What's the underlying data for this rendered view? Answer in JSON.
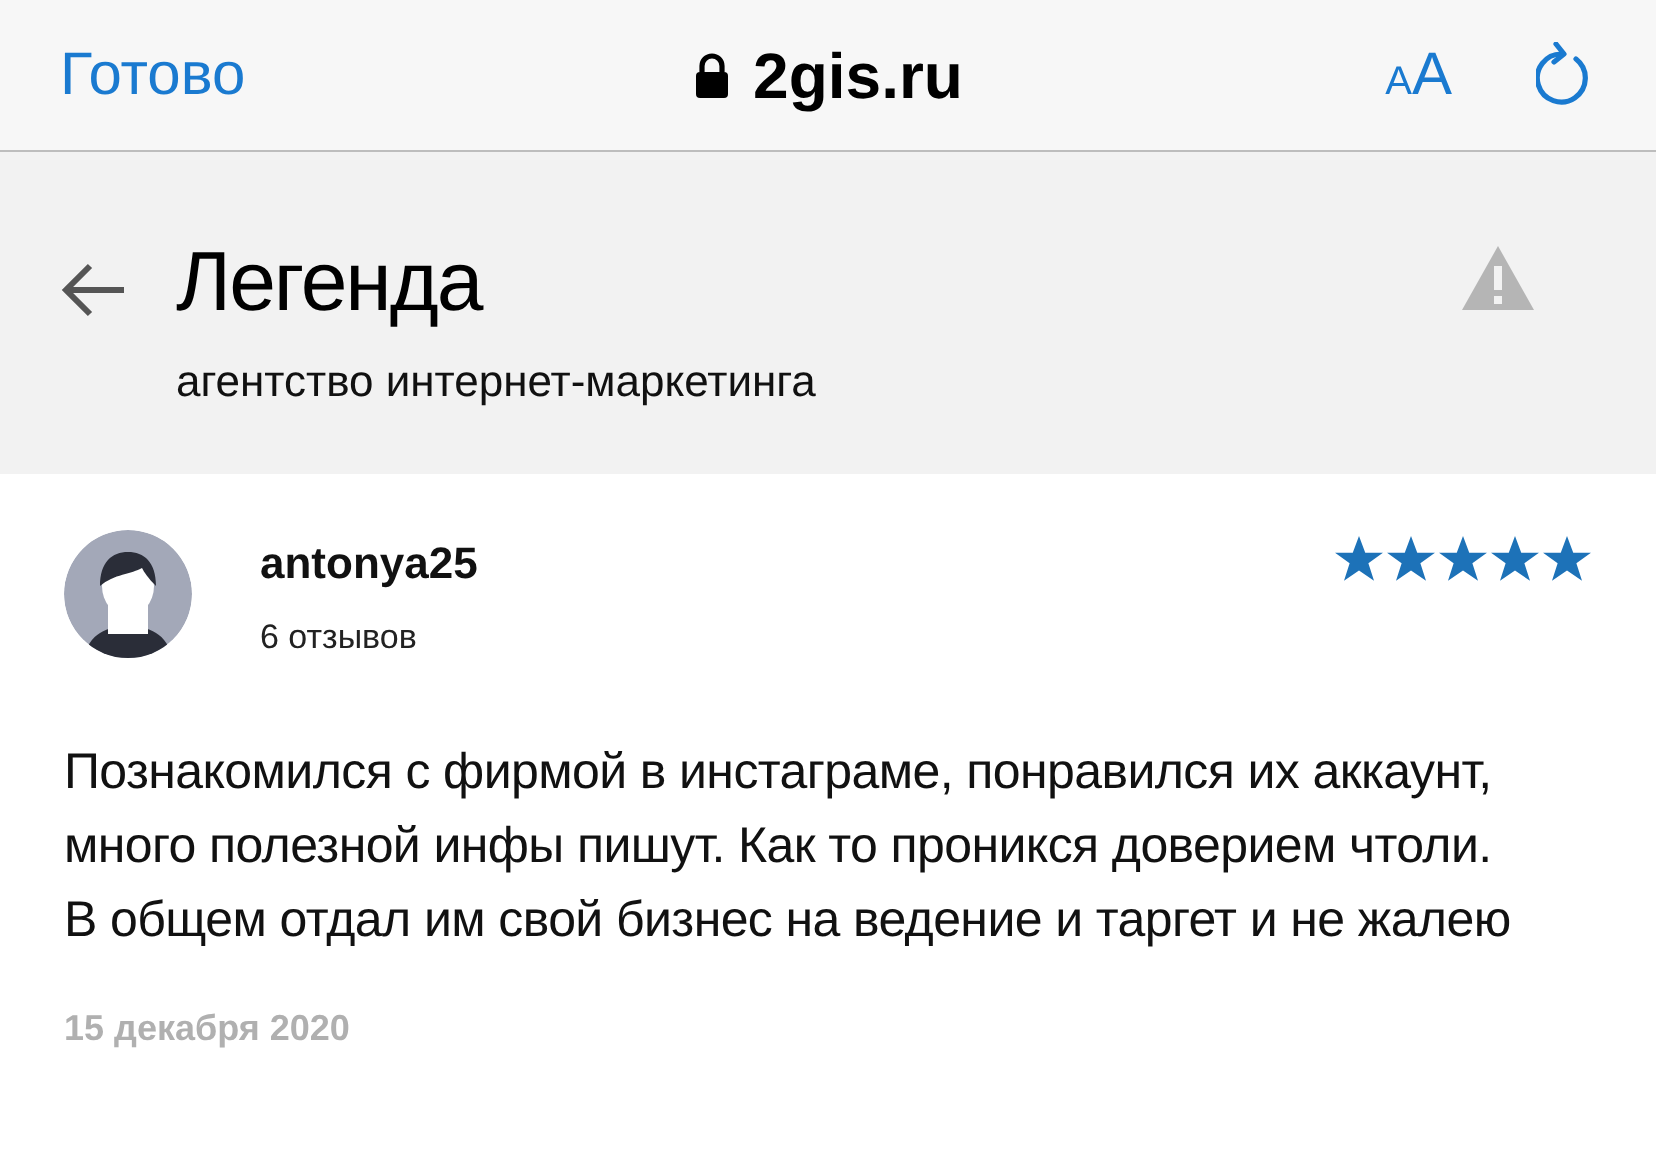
{
  "browser_bar": {
    "done": "Готово",
    "address": "2gis.ru",
    "secure": true,
    "text_size": {
      "small": "A",
      "large": "A"
    }
  },
  "header": {
    "title": "Легенда",
    "subtitle": "агентство интернет-маркетинга"
  },
  "review": {
    "author": "antonya25",
    "review_count": "6 отзывов",
    "stars": 5,
    "text": "Познакомился с фирмой в инстаграме, понравился их аккаунт, много полезной инфы пишут. Как то проникся доверием чтоли. В общем отдал им свой бизнес на ведение и таргет и не жалею",
    "date": "15 декабря 2020"
  }
}
